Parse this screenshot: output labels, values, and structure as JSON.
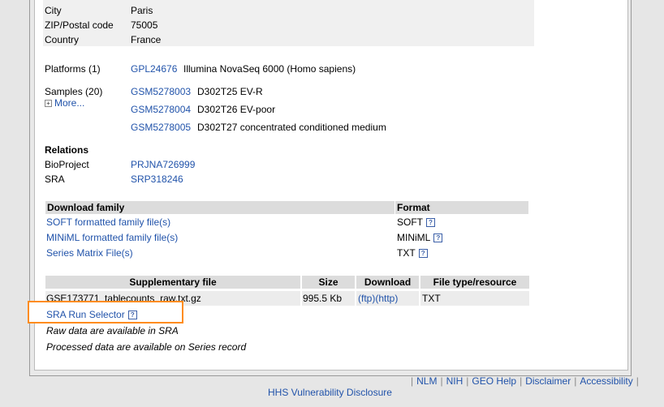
{
  "contact": {
    "city_label": "City",
    "city_value": "Paris",
    "zip_label": "ZIP/Postal code",
    "zip_value": "75005",
    "country_label": "Country",
    "country_value": "France"
  },
  "platforms": {
    "label": "Platforms (1)",
    "items": [
      {
        "id": "GPL24676",
        "desc": "Illumina NovaSeq 6000 (Homo sapiens)"
      }
    ]
  },
  "samples": {
    "label": "Samples (20)",
    "more": "More...",
    "items": [
      {
        "id": "GSM5278003",
        "desc": "D302T25 EV-R"
      },
      {
        "id": "GSM5278004",
        "desc": "D302T26 EV-poor"
      },
      {
        "id": "GSM5278005",
        "desc": "D302T27 concentrated conditioned medium"
      }
    ]
  },
  "relations": {
    "label": "Relations",
    "items": [
      {
        "key": "BioProject",
        "value": "PRJNA726999"
      },
      {
        "key": "SRA",
        "value": "SRP318246"
      }
    ]
  },
  "download": {
    "header_family": "Download family",
    "header_format": "Format",
    "rows": [
      {
        "name": "SOFT formatted family file(s)",
        "format": "SOFT"
      },
      {
        "name": "MINiML formatted family file(s)",
        "format": "MINiML"
      },
      {
        "name": "Series Matrix File(s)",
        "format": "TXT"
      }
    ]
  },
  "supplementary": {
    "headers": [
      "Supplementary file",
      "Size",
      "Download",
      "File type/resource"
    ],
    "rows": [
      {
        "file": "GSE173771_tablecounts_raw.txt.gz",
        "size": "995.5 Kb",
        "ftp": "(ftp)",
        "http": "(http)",
        "type": "TXT"
      }
    ],
    "sra_selector": "SRA Run Selector",
    "notes": [
      "Raw data are available in SRA",
      "Processed data are available on Series record"
    ]
  },
  "footer": {
    "links": [
      "NLM",
      "NIH",
      "GEO Help",
      "Disclaimer",
      "Accessibility"
    ],
    "hhs": "HHS Vulnerability Disclosure"
  },
  "help_glyph": "?",
  "plus_glyph": "+"
}
